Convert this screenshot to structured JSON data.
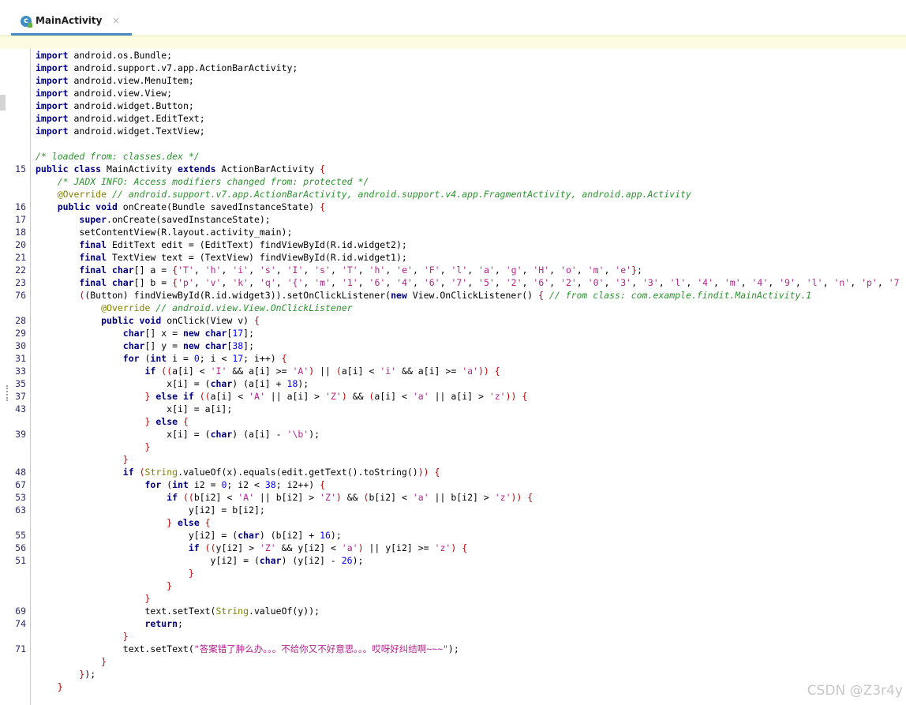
{
  "tab": {
    "title": "MainActivity",
    "close": "×",
    "icon_letter": "c"
  },
  "editor": {
    "line_numbers": [
      "",
      "",
      "",
      "",
      "",
      "",
      "",
      "",
      "",
      "15",
      "",
      "",
      "16",
      "17",
      "18",
      "20",
      "21",
      "22",
      "23",
      "76",
      "",
      "28",
      "29",
      "30",
      "31",
      "33",
      "35",
      "37",
      "43",
      "",
      "39",
      "",
      "",
      "48",
      "67",
      "53",
      "63",
      "",
      "55",
      "56",
      "51",
      "",
      "",
      "",
      "69",
      "74",
      "",
      "71",
      "",
      "",
      ""
    ],
    "code_lines": [
      "<span class=\"kw\">import</span> android.os.Bundle;",
      "<span class=\"kw\">import</span> android.support.v7.app.ActionBarActivity;",
      "<span class=\"kw\">import</span> android.view.MenuItem;",
      "<span class=\"kw\">import</span> android.view.View;",
      "<span class=\"kw\">import</span> android.widget.Button;",
      "<span class=\"kw\">import</span> android.widget.EditText;",
      "<span class=\"kw\">import</span> android.widget.TextView;",
      "",
      "<span class=\"cm\">/* loaded from: classes.dex */</span>",
      "<span class=\"kw\">public class</span> MainActivity <span class=\"kw\">extends</span> ActionBarActivity <span class=\"red\">{</span>",
      "    <span class=\"cm\">/* JADX INFO: Access modifiers changed from: protected */</span>",
      "    <span class=\"an\">@Override</span> <span class=\"cm\">// android.support.v7.app.ActionBarActivity, android.support.v4.app.FragmentActivity, android.app.Activity</span>",
      "    <span class=\"kw\">public void</span> onCreate(Bundle savedInstanceState) <span class=\"red\">{</span>",
      "        <span class=\"kw\">super</span>.onCreate(savedInstanceState);",
      "        setContentView(R.layout.activity_main);",
      "        <span class=\"kw\">final</span> EditText edit = (EditText) findViewById(R.id.widget2);",
      "        <span class=\"kw\">final</span> TextView text = (TextView) findViewById(R.id.widget1);",
      "        <span class=\"kw\">final char</span>[] a = <span class=\"red\">{</span><span class=\"stc\">'T'</span>, <span class=\"stc\">'h'</span>, <span class=\"stc\">'i'</span>, <span class=\"stc\">'s'</span>, <span class=\"stc\">'I'</span>, <span class=\"stc\">'s'</span>, <span class=\"stc\">'T'</span>, <span class=\"stc\">'h'</span>, <span class=\"stc\">'e'</span>, <span class=\"stc\">'F'</span>, <span class=\"stc\">'l'</span>, <span class=\"stc\">'a'</span>, <span class=\"stc\">'g'</span>, <span class=\"stc\">'H'</span>, <span class=\"stc\">'o'</span>, <span class=\"stc\">'m'</span>, <span class=\"stc\">'e'</span><span class=\"red\">}</span>;",
      "        <span class=\"kw\">final char</span>[] b = <span class=\"red\">{</span><span class=\"stc\">'p'</span>, <span class=\"stc\">'v'</span>, <span class=\"stc\">'k'</span>, <span class=\"stc\">'q'</span>, <span class=\"stc\">'{'</span>, <span class=\"stc\">'m'</span>, <span class=\"stc\">'1'</span>, <span class=\"stc\">'6'</span>, <span class=\"stc\">'4'</span>, <span class=\"stc\">'6'</span>, <span class=\"stc\">'7'</span>, <span class=\"stc\">'5'</span>, <span class=\"stc\">'2'</span>, <span class=\"stc\">'6'</span>, <span class=\"stc\">'2'</span>, <span class=\"stc\">'0'</span>, <span class=\"stc\">'3'</span>, <span class=\"stc\">'3'</span>, <span class=\"stc\">'l'</span>, <span class=\"stc\">'4'</span>, <span class=\"stc\">'m'</span>, <span class=\"stc\">'4'</span>, <span class=\"stc\">'9'</span>, <span class=\"stc\">'l'</span>, <span class=\"stc\">'n'</span>, <span class=\"stc\">'p'</span>, <span class=\"stc\">'7</span>",
      "        <span class=\"red\">(</span>(Button) findViewById(R.id.widget3)).setOnClickListener(<span class=\"kw\">new</span> View.OnClickListener() <span class=\"red\">{</span> <span class=\"cm\">// from class: com.example.findit.MainActivity.1</span>",
      "            <span class=\"an\">@Override</span> <span class=\"cm\">// android.view.View.OnClickListener</span>",
      "            <span class=\"kw\">public void</span> onClick(View v) <span class=\"red\">{</span>",
      "                <span class=\"ty\">char</span>[] x = <span class=\"kw\">new</span> <span class=\"ty\">char</span>[<span class=\"nm\">17</span>];",
      "                <span class=\"ty\">char</span>[] y = <span class=\"kw\">new</span> <span class=\"ty\">char</span>[<span class=\"nm\">38</span>];",
      "                <span class=\"kw\">for</span> (<span class=\"ty\">int</span> i = <span class=\"nm\">0</span>; i &lt; <span class=\"nm\">17</span>; i++) <span class=\"red\">{</span>",
      "                    <span class=\"kw\">if</span> <span class=\"red\">((</span>a[i] &lt; <span class=\"stc\">'I'</span> &amp;&amp; a[i] &gt;= <span class=\"stc\">'A'</span><span class=\"red\">)</span> || <span class=\"red\">(</span>a[i] &lt; <span class=\"stc\">'i'</span> &amp;&amp; a[i] &gt;= <span class=\"stc\">'a'</span><span class=\"red\">))</span> <span class=\"red\">{</span>",
      "                        x[i] = (<span class=\"ty\">char</span>) (a[i] + <span class=\"nm\">18</span>);",
      "                    <span class=\"red\">}</span> <span class=\"kw\">else if</span> <span class=\"red\">((</span>a[i] &lt; <span class=\"stc\">'A'</span> || a[i] &gt; <span class=\"stc\">'Z'</span><span class=\"red\">)</span> &amp;&amp; <span class=\"red\">(</span>a[i] &lt; <span class=\"stc\">'a'</span> || a[i] &gt; <span class=\"stc\">'z'</span><span class=\"red\">))</span> <span class=\"red\">{</span>",
      "                        x[i] = a[i];",
      "                    <span class=\"red\">}</span> <span class=\"kw\">else</span> <span class=\"red\">{</span>",
      "                        x[i] = (<span class=\"ty\">char</span>) (a[i] - <span class=\"stc\">'\\b'</span>);",
      "                    <span class=\"red\">}</span>",
      "                <span class=\"red\">}</span>",
      "                <span class=\"kw\">if</span> <span class=\"red\">(</span><span class=\"an\">String</span>.valueOf(x).equals(edit.getText().toString()<span class=\"red\">))</span> <span class=\"red\">{</span>",
      "                    <span class=\"kw\">for</span> (<span class=\"ty\">int</span> i2 = <span class=\"nm\">0</span>; i2 &lt; <span class=\"nm\">38</span>; i2++) <span class=\"red\">{</span>",
      "                        <span class=\"kw\">if</span> <span class=\"red\">((</span>b[i2] &lt; <span class=\"stc\">'A'</span> || b[i2] &gt; <span class=\"stc\">'Z'</span><span class=\"red\">)</span> &amp;&amp; <span class=\"red\">(</span>b[i2] &lt; <span class=\"stc\">'a'</span> || b[i2] &gt; <span class=\"stc\">'z'</span><span class=\"red\">))</span> <span class=\"red\">{</span>",
      "                            y[i2] = b[i2];",
      "                        <span class=\"red\">}</span> <span class=\"kw\">else</span> <span class=\"red\">{</span>",
      "                            y[i2] = (<span class=\"ty\">char</span>) (b[i2] + <span class=\"nm\">16</span>);",
      "                            <span class=\"kw\">if</span> <span class=\"red\">((</span>y[i2] &gt; <span class=\"stc\">'Z'</span> &amp;&amp; y[i2] &lt; <span class=\"stc\">'a'</span><span class=\"red\">)</span> || y[i2] &gt;= <span class=\"stc\">'z'</span><span class=\"red\">)</span> <span class=\"red\">{</span>",
      "                                y[i2] = (<span class=\"ty\">char</span>) (y[i2] - <span class=\"nm\">26</span>);",
      "                            <span class=\"red\">}</span>",
      "                        <span class=\"red\">}</span>",
      "                    <span class=\"red\">}</span>",
      "                    text.setText(<span class=\"an\">String</span>.valueOf(y));",
      "                    <span class=\"kw\">return</span>;",
      "                <span class=\"red\">}</span>",
      "                text.setText(<span class=\"stc\">\"答案错了肿么办。。。不给你又不好意思。。。哎呀好纠结啊~~~\"</span>);",
      "            <span class=\"red\">}</span>",
      "        <span class=\"red\">}</span>);",
      "    <span class=\"red\">}</span>"
    ]
  },
  "watermark": "CSDN @Z3r4y"
}
